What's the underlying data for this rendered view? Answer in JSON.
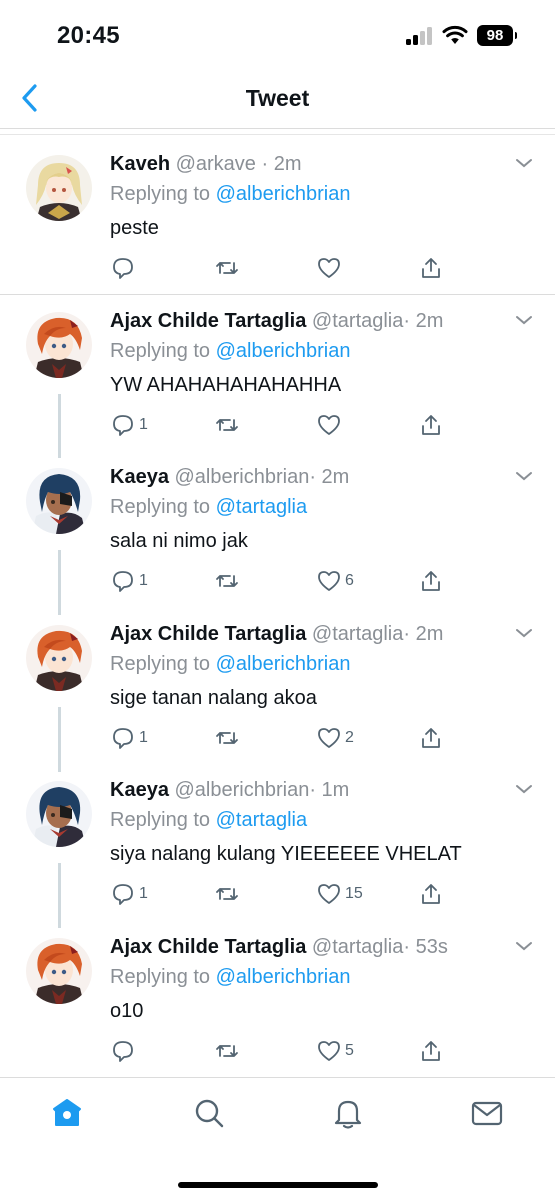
{
  "status_bar": {
    "time": "20:45",
    "battery": "98"
  },
  "nav": {
    "title": "Tweet"
  },
  "tweets": [
    {
      "name": "Kaveh",
      "handle": "@arkave",
      "time": "· 2m",
      "replying_prefix": "Replying to ",
      "replying_to": "@alberichbrian",
      "text": "peste",
      "replies": "",
      "retweets": "",
      "likes": ""
    },
    {
      "name": "Ajax Childe Tartaglia",
      "handle": "@tartaglia",
      "time": "· 2m",
      "replying_prefix": "Replying to ",
      "replying_to": "@alberichbrian",
      "text": "YW AHAHAHAHAHAHHA",
      "replies": "1",
      "retweets": "",
      "likes": ""
    },
    {
      "name": "Kaeya",
      "handle": "@alberichbrian",
      "time": "· 2m",
      "replying_prefix": "Replying to ",
      "replying_to": "@tartaglia",
      "text": "sala ni nimo jak",
      "replies": "1",
      "retweets": "",
      "likes": "6"
    },
    {
      "name": "Ajax Childe Tartaglia",
      "handle": "@tartaglia",
      "time": "· 2m",
      "replying_prefix": "Replying to ",
      "replying_to": "@alberichbrian",
      "text": "sige tanan nalang akoa",
      "replies": "1",
      "retweets": "",
      "likes": "2"
    },
    {
      "name": "Kaeya",
      "handle": "@alberichbrian",
      "time": "· 1m",
      "replying_prefix": "Replying to ",
      "replying_to": "@tartaglia",
      "text": "siya nalang kulang YIEEEEEE VHELAT",
      "replies": "1",
      "retweets": "",
      "likes": "15"
    },
    {
      "name": "Ajax Childe Tartaglia",
      "handle": "@tartaglia",
      "time": "· 53s",
      "replying_prefix": "Replying to ",
      "replying_to": "@alberichbrian",
      "text": "o10",
      "replies": "",
      "retweets": "",
      "likes": "5"
    }
  ],
  "colors": {
    "accent": "#1d9bf0",
    "secondary_text": "#8a8f95",
    "icon": "#536471"
  }
}
